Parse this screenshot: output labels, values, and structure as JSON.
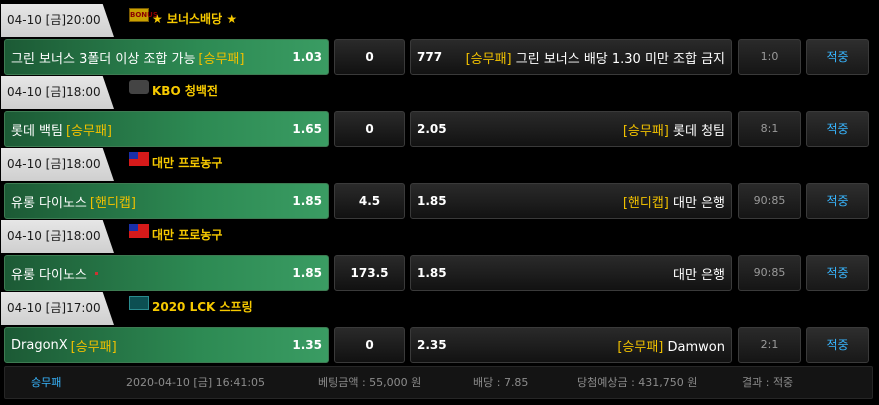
{
  "sections": [
    {
      "header": {
        "datetime": "04-10 [금]20:00",
        "icon": "bonus-icon",
        "icon_text": "BONUS",
        "title": "★ 보너스배당 ★"
      },
      "home": {
        "name": "그린 보너스 3폴더 이상 조합 가능",
        "tag": "[승무패]",
        "odds": "1.03"
      },
      "mid": "0",
      "away": {
        "odds": "777",
        "tag": "[승무패]",
        "name": "그린 보너스 배당 1.30 미만 조합 금지"
      },
      "score": "1:0",
      "result": "적중"
    },
    {
      "header": {
        "datetime": "04-10 [금]18:00",
        "icon": "baseball-icon",
        "title": "KBO 청백전"
      },
      "home": {
        "name": "롯데 백팀",
        "tag": "[승무패]",
        "odds": "1.65"
      },
      "mid": "0",
      "away": {
        "odds": "2.05",
        "tag": "[승무패]",
        "name": "롯데 청팀"
      },
      "score": "8:1",
      "result": "적중"
    },
    {
      "header": {
        "datetime": "04-10 [금]18:00",
        "icon": "taiwan-flag-icon",
        "title": "대만 프로농구"
      },
      "home": {
        "name": "유롱 다이노스",
        "tag": "[핸디캡]",
        "odds": "1.85"
      },
      "mid": "4.5",
      "away": {
        "odds": "1.85",
        "tag": "[핸디캡]",
        "name": "대만 은행"
      },
      "score": "90:85",
      "result": "적중"
    },
    {
      "header": {
        "datetime": "04-10 [금]18:00",
        "icon": "taiwan-flag-icon",
        "title": "대만 프로농구"
      },
      "home": {
        "name": "유롱 다이노스",
        "tag": "",
        "odds": "1.85"
      },
      "mid": "173.5",
      "away": {
        "odds": "1.85",
        "tag": "",
        "name": "대만 은행"
      },
      "score": "90:85",
      "result": "적중"
    },
    {
      "header": {
        "datetime": "04-10 [금]17:00",
        "icon": "lck-icon",
        "title": "2020 LCK 스프링"
      },
      "home": {
        "name": "DragonX",
        "tag": "[승무패]",
        "odds": "1.35"
      },
      "mid": "0",
      "away": {
        "odds": "2.35",
        "tag": "[승무패]",
        "name": "Damwon"
      },
      "score": "2:1",
      "result": "적중"
    }
  ],
  "footer": {
    "type": "승무패",
    "datetime": "2020-04-10 [금] 16:41:05",
    "bet_amount": "베팅금액 : 55,000 원",
    "odds": "배당 : 7.85",
    "expected_win": "당첨예상금 : 431,750 원",
    "result": "결과 : 적중"
  },
  "colors": {
    "accent_yellow": "#f6c900",
    "result_blue": "#38b6ff",
    "home_green": "#2d8a53"
  }
}
